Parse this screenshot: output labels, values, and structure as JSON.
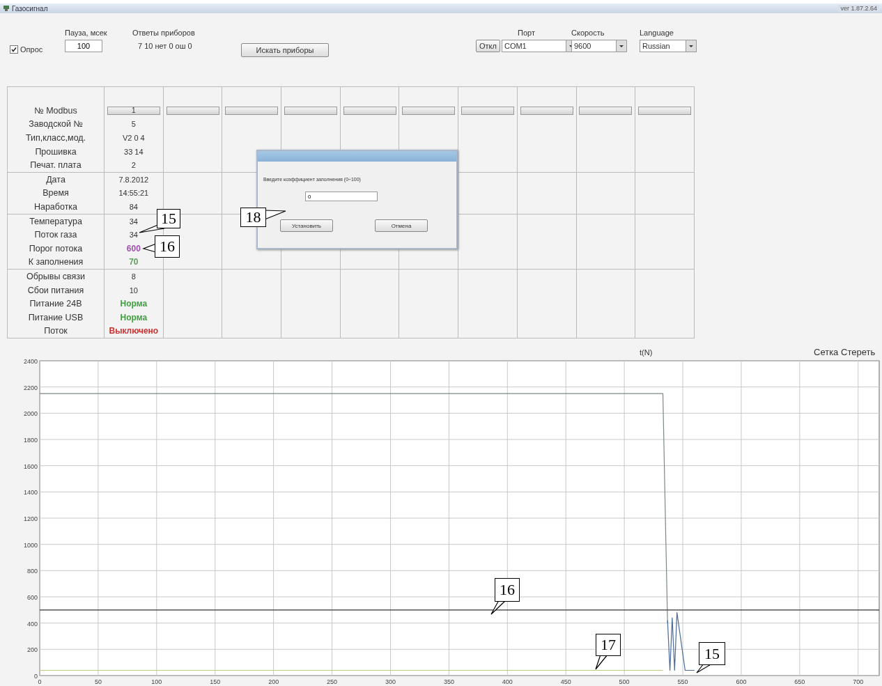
{
  "window": {
    "title": "Газосигнал",
    "version": "ver 1.87.2.64"
  },
  "controls": {
    "poll": {
      "label": "Опрос",
      "checked": true
    },
    "pause": {
      "label": "Пауза, мсек",
      "value": "100"
    },
    "answers": {
      "label": "Ответы приборов",
      "value": "7 10 нет 0 ош 0"
    },
    "search_button": "Искать приборы",
    "port": {
      "label": "Порт",
      "button": "Откл",
      "value": "COM1"
    },
    "speed": {
      "label": "Скорость",
      "value": "9600"
    },
    "language": {
      "label": "Language",
      "value": "Russian"
    }
  },
  "table": {
    "row_groups": [
      [
        "№ Modbus",
        "Заводской №",
        "Тип,класс,мод.",
        "Прошивка",
        "Печат. плата"
      ],
      [
        "Дата",
        "Время",
        "Наработка"
      ],
      [
        "Температура",
        "Поток газа",
        "Порог потока",
        "К заполнения"
      ],
      [
        "Обрывы связи",
        "Сбои питания",
        "Питание 24В",
        "Питание USB",
        "Поток"
      ]
    ],
    "devices": [
      {
        "kind": "device",
        "modbus": "1",
        "values": [
          {
            "text": "5"
          },
          {
            "text": "V2 0 4"
          },
          {
            "text": "33 14"
          },
          {
            "text": "2"
          },
          {
            "text": "7.8.2012"
          },
          {
            "text": "14:55:21"
          },
          {
            "text": "84"
          },
          {
            "text": "34"
          },
          {
            "text": "34"
          },
          {
            "text": "600",
            "color": "#a050b0"
          },
          {
            "text": "70",
            "color": "#60a060"
          },
          {
            "text": "8"
          },
          {
            "text": "10"
          },
          {
            "text": "Норма",
            "color": "#40a040"
          },
          {
            "text": "Норма",
            "color": "#40a040"
          },
          {
            "text": "Выключено",
            "color": "#d03030"
          }
        ]
      },
      {
        "kind": "empty"
      },
      {
        "kind": "empty"
      },
      {
        "kind": "empty"
      },
      {
        "kind": "empty"
      },
      {
        "kind": "empty"
      },
      {
        "kind": "empty"
      },
      {
        "kind": "empty"
      },
      {
        "kind": "empty"
      },
      {
        "kind": "empty"
      }
    ]
  },
  "dialog": {
    "prompt": "Введите коэффициент заполнения (0÷100)",
    "value": "0",
    "buttons": [
      "Установить",
      "Отмена"
    ]
  },
  "chart": {
    "xlabel": "t(N)",
    "buttons": [
      "Сетка",
      "Стереть"
    ],
    "chart_data": {
      "type": "line",
      "grid": true,
      "x": [
        0,
        100,
        200,
        300,
        400,
        500,
        530,
        533,
        535,
        537,
        539,
        541,
        543,
        545,
        552,
        560,
        718
      ],
      "xlim": [
        0,
        718
      ],
      "ylim": [
        0,
        2400
      ],
      "xticks": [
        0,
        50,
        100,
        150,
        200,
        250,
        300,
        350,
        400,
        450,
        500,
        550,
        600,
        650,
        700
      ],
      "yticks": [
        0,
        200,
        400,
        600,
        800,
        1000,
        1200,
        1400,
        1600,
        1800,
        2000,
        2200,
        2400
      ],
      "series": [
        {
          "color": "#7a8a80",
          "values": [
            2150,
            2150,
            2150,
            2150,
            2150,
            2150,
            2150,
            2150,
            1250,
            400,
            null,
            null,
            null,
            null,
            null,
            null,
            null
          ]
        },
        {
          "color": "#4a6a9a",
          "values": [
            null,
            null,
            null,
            null,
            null,
            null,
            null,
            null,
            null,
            420,
            40,
            440,
            40,
            480,
            40,
            40,
            null
          ]
        },
        {
          "color": "#333333",
          "values": [
            500,
            500,
            500,
            500,
            500,
            500,
            500,
            500,
            500,
            500,
            500,
            500,
            500,
            500,
            500,
            500,
            500
          ]
        },
        {
          "color": "#b5d080",
          "values": [
            40,
            40,
            40,
            40,
            40,
            40,
            40,
            40,
            null,
            null,
            null,
            null,
            null,
            null,
            null,
            null,
            null
          ]
        }
      ]
    }
  },
  "callouts": [
    {
      "text": "15"
    },
    {
      "text": "16"
    },
    {
      "text": "18"
    },
    {
      "text": "16"
    },
    {
      "text": "17"
    },
    {
      "text": "15"
    }
  ]
}
